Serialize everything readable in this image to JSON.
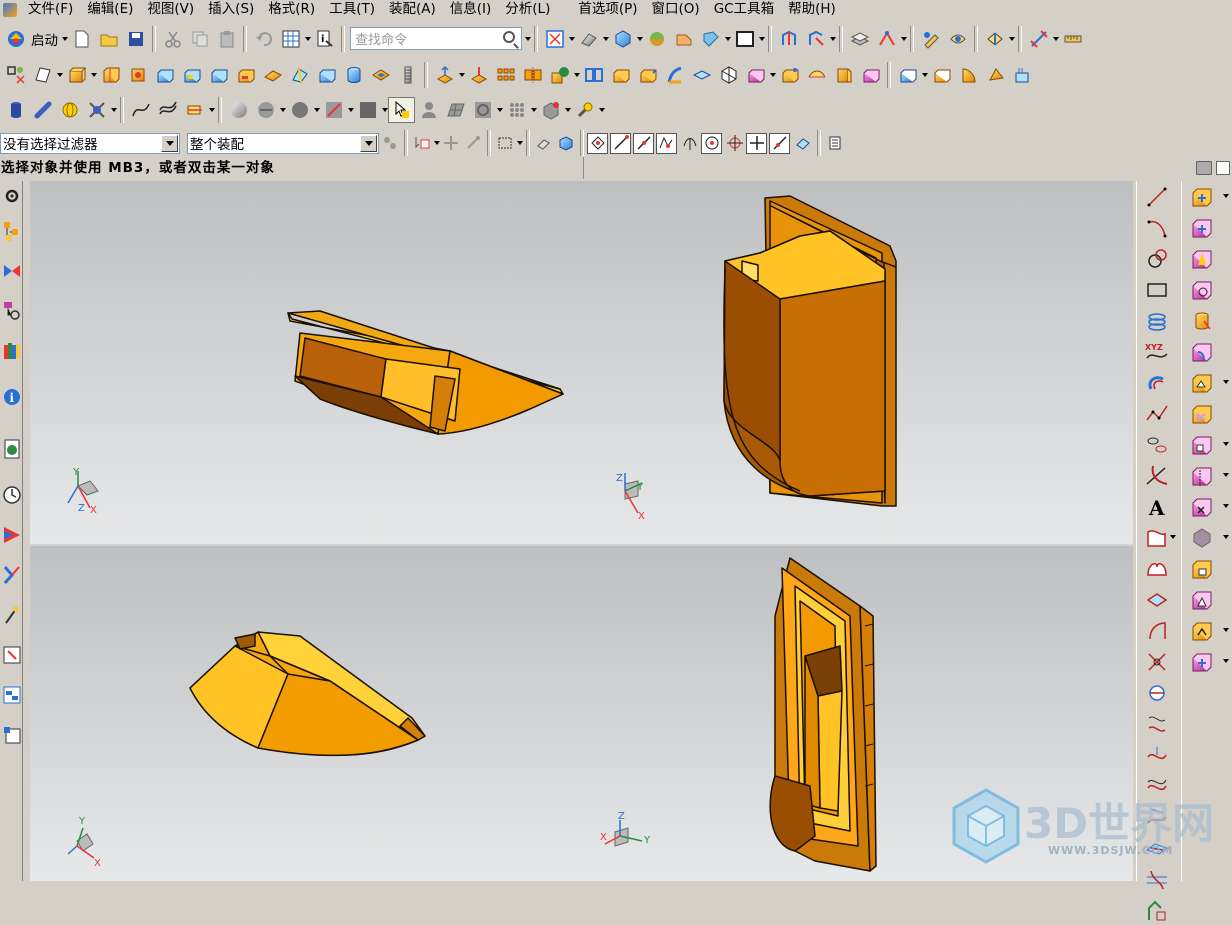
{
  "menubar": {
    "items": [
      "文件(F)",
      "编辑(E)",
      "视图(V)",
      "插入(S)",
      "格式(R)",
      "工具(T)",
      "装配(A)",
      "信息(I)",
      "分析(L)",
      "首选项(P)",
      "窗口(O)",
      "GC工具箱",
      "帮助(H)"
    ]
  },
  "toolbar": {
    "start_label": "启动",
    "search_placeholder": "查找命令"
  },
  "selection_bar": {
    "filter_value": "没有选择过滤器",
    "scope_value": "整个装配"
  },
  "cue_line": {
    "text": "选择对象并使用 MB3，或者双击某一对象"
  },
  "triads": {
    "vp1_left": {
      "labels": [
        "Y",
        "Z",
        "X"
      ]
    },
    "vp1_right": {
      "labels": [
        "Z",
        "Y",
        "X"
      ]
    },
    "vp2_left": {
      "labels": [
        "Y",
        "X"
      ]
    },
    "vp2_right": {
      "labels": [
        "Z",
        "X",
        "Y"
      ]
    }
  },
  "right_toolbar": {
    "xyz_label": "XYZ",
    "text_tool_label": "A"
  },
  "watermark": {
    "text": "3D世界网",
    "url": "WWW.3DSJW.COM"
  },
  "colors": {
    "part_orange": "#f4a00c",
    "part_dark": "#a05a00",
    "background_top": "#bdbfc1",
    "background_bottom": "#e7e8e9"
  }
}
